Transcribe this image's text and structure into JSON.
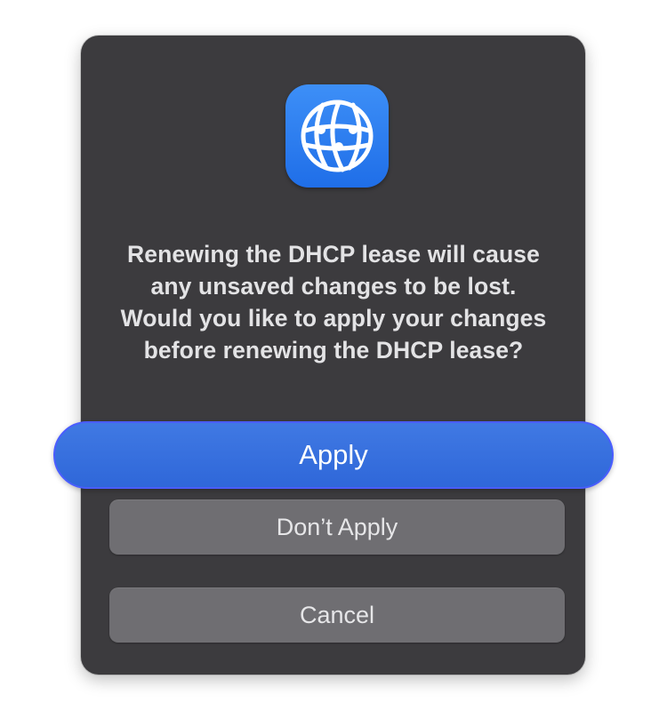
{
  "dialog": {
    "app_icon": "network-globe-icon",
    "message": "Renewing the DHCP lease will cause any unsaved changes to be lost. Would you like to apply your changes before renewing the DHCP lease?",
    "buttons": {
      "apply": "Apply",
      "dont_apply": "Don’t Apply",
      "cancel": "Cancel"
    }
  },
  "colors": {
    "dialog_background": "#3c3b3e",
    "icon_background": "#2f7ff0",
    "primary_button": "#3570dd",
    "secondary_button": "#6f6e72",
    "text": "#e3e3e5"
  }
}
